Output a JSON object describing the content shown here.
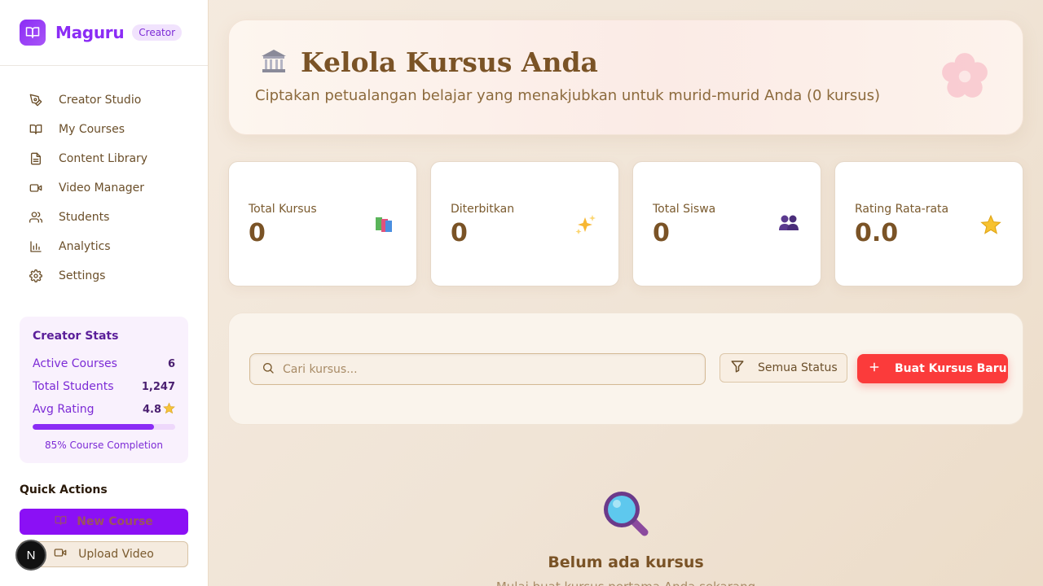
{
  "brand": {
    "name": "Maguru",
    "badge": "Creator"
  },
  "sidebar": {
    "items": [
      {
        "label": "Creator Studio",
        "icon": "pen-tool-icon"
      },
      {
        "label": "My Courses",
        "icon": "book-open-icon"
      },
      {
        "label": "Content Library",
        "icon": "file-text-icon"
      },
      {
        "label": "Video Manager",
        "icon": "video-icon"
      },
      {
        "label": "Students",
        "icon": "users-icon"
      },
      {
        "label": "Analytics",
        "icon": "bar-chart-icon"
      },
      {
        "label": "Settings",
        "icon": "gear-icon"
      }
    ],
    "creator_stats": {
      "title": "Creator Stats",
      "rows": [
        {
          "label": "Active Courses",
          "value": "6"
        },
        {
          "label": "Total Students",
          "value": "1,247"
        },
        {
          "label": "Avg Rating",
          "value": "4.8"
        }
      ],
      "completion": 0.85,
      "completion_label": "85% Course Completion"
    },
    "quick_actions": {
      "title": "Quick Actions",
      "new_course": "New Course",
      "upload_video": "Upload Video"
    }
  },
  "next_badge": "N",
  "hero": {
    "emoji": "🏛️",
    "title": "Kelola Kursus Anda",
    "subtitle": "Ciptakan petualangan belajar yang menakjubkan untuk murid-murid Anda (0 kursus)"
  },
  "stats": [
    {
      "label": "Total Kursus",
      "value": "0",
      "emoji": "📚"
    },
    {
      "label": "Diterbitkan",
      "value": "0",
      "emoji": "✨"
    },
    {
      "label": "Total Siswa",
      "value": "0",
      "emoji": "👥"
    },
    {
      "label": "Rating Rata-rata",
      "value": "0.0",
      "emoji": "⭐"
    }
  ],
  "toolbar": {
    "search_placeholder": "Cari kursus...",
    "filter_label": "Semua Status",
    "create_label": "Buat Kursus Baru"
  },
  "empty_state": {
    "title": "Belum ada kursus",
    "subtitle": "Mulai buat kursus pertama Anda sekarang"
  },
  "colors": {
    "accent": "#8b2cf5",
    "create_button": "#fb3b3b",
    "brown_text": "#7a5326"
  }
}
